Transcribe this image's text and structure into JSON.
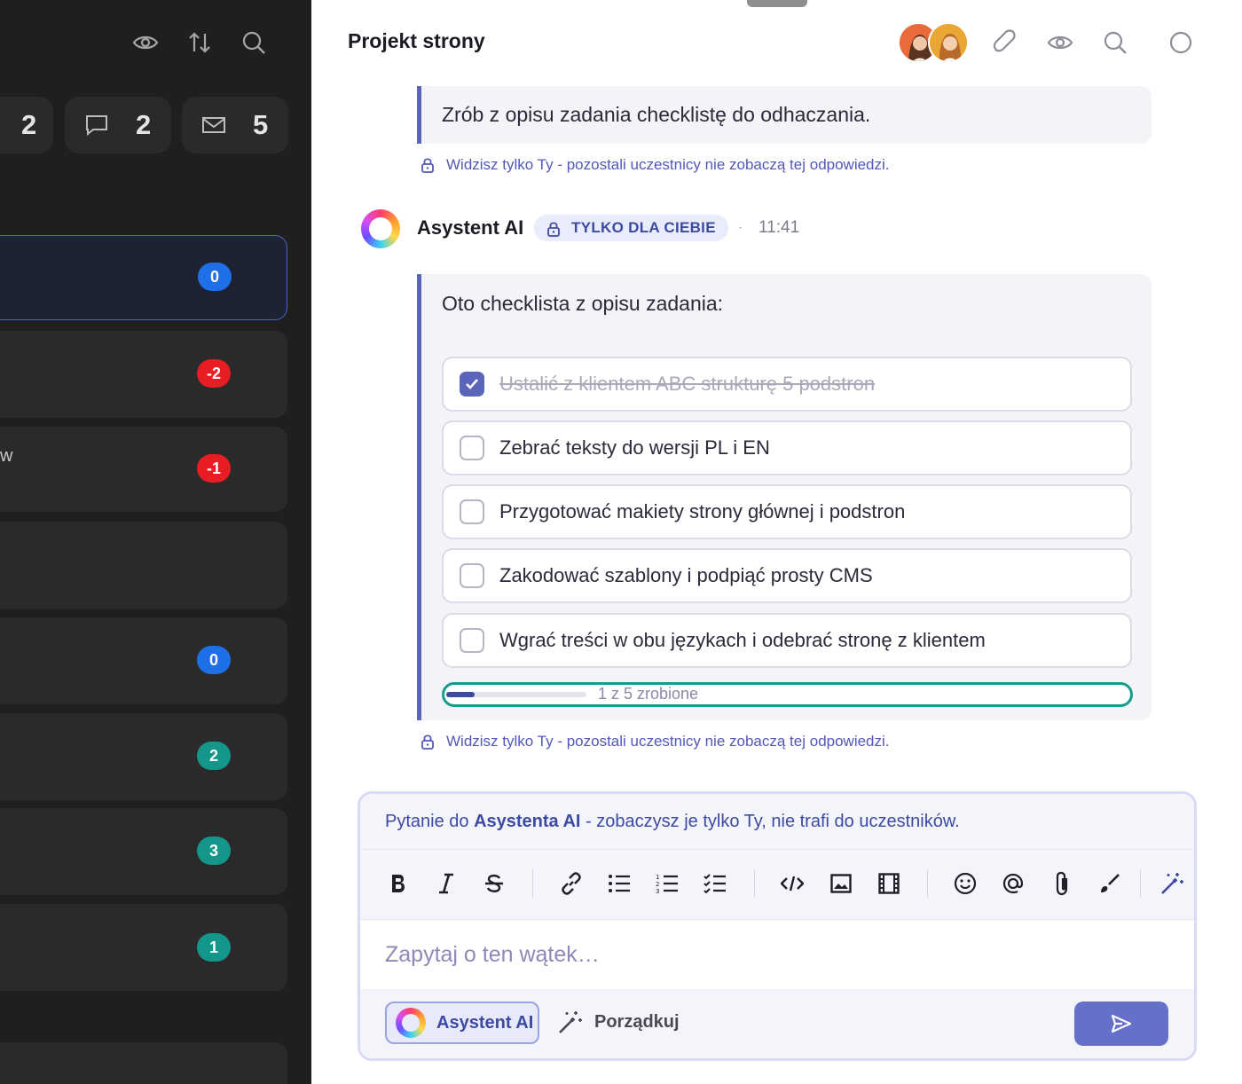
{
  "left_panel": {
    "stats": [
      {
        "icon": "checklist-icon",
        "value": "2"
      },
      {
        "icon": "comment-icon",
        "value": "2"
      },
      {
        "icon": "mail-icon",
        "value": "5"
      }
    ],
    "rows": [
      {
        "badge": "0",
        "color": "#1f6fe8"
      },
      {
        "badge": "-2",
        "color": "#e81c23"
      },
      {
        "badge": "-1",
        "color": "#e81c23",
        "text_fragment": "w"
      },
      {
        "badge": ""
      },
      {
        "badge": "0",
        "color": "#1f6fe8"
      },
      {
        "badge": "2",
        "color": "#15968a"
      },
      {
        "badge": "3",
        "color": "#15968a"
      },
      {
        "badge": "1",
        "color": "#15968a"
      }
    ]
  },
  "header": {
    "title": "Projekt strony"
  },
  "chat": {
    "prompt": "Zrób z opisu zadania checklistę do odhaczania.",
    "private_note": "Widzisz tylko Ty - pozostali uczestnicy nie zobaczą tej odpowiedzi.",
    "ai_name": "Asystent AI",
    "only_you_badge": "TYLKO DLA CIEBIE",
    "separator": "·",
    "time": "11:41",
    "answer_lead": "Oto checklista z opisu zadania:",
    "checklist": [
      {
        "text": "Ustalić z klientem ABC strukturę 5 podstron",
        "checked": true
      },
      {
        "text": "Zebrać teksty do wersji PL i EN",
        "checked": false
      },
      {
        "text": "Przygotować makiety strony głównej i podstron",
        "checked": false
      },
      {
        "text": "Zakodować szablony i podpiąć prosty CMS",
        "checked": false
      },
      {
        "text": "Wgrać treści w obu językach i odebrać stronę z klientem",
        "checked": false
      }
    ],
    "progress": {
      "done": 1,
      "total": 5,
      "label": "1 z 5 zrobione"
    },
    "private_note_2": "Widzisz tylko Ty - pozostali uczestnicy nie zobaczą tej odpowiedzi."
  },
  "composer": {
    "hint_prefix": "Pytanie do ",
    "hint_bold": "Asystenta AI",
    "hint_suffix": " - zobaczysz je tylko Ty, nie trafi do uczestników.",
    "placeholder": "Zapytaj o ten wątek…",
    "ai_button": "Asystent AI",
    "tidy_button": "Porządkuj",
    "toolbar": [
      "bold-icon",
      "italic-icon",
      "strikethrough-icon",
      "link-icon",
      "bullet-list-icon",
      "numbered-list-icon",
      "checklist-icon",
      "code-icon",
      "image-icon",
      "video-icon",
      "emoji-icon",
      "mention-icon",
      "attachment-icon",
      "brush-icon",
      "magic-wand-icon"
    ]
  },
  "colors": {
    "accent": "#5a64b8",
    "teal": "#159c8e",
    "dark_bg": "#1f1f1f"
  }
}
